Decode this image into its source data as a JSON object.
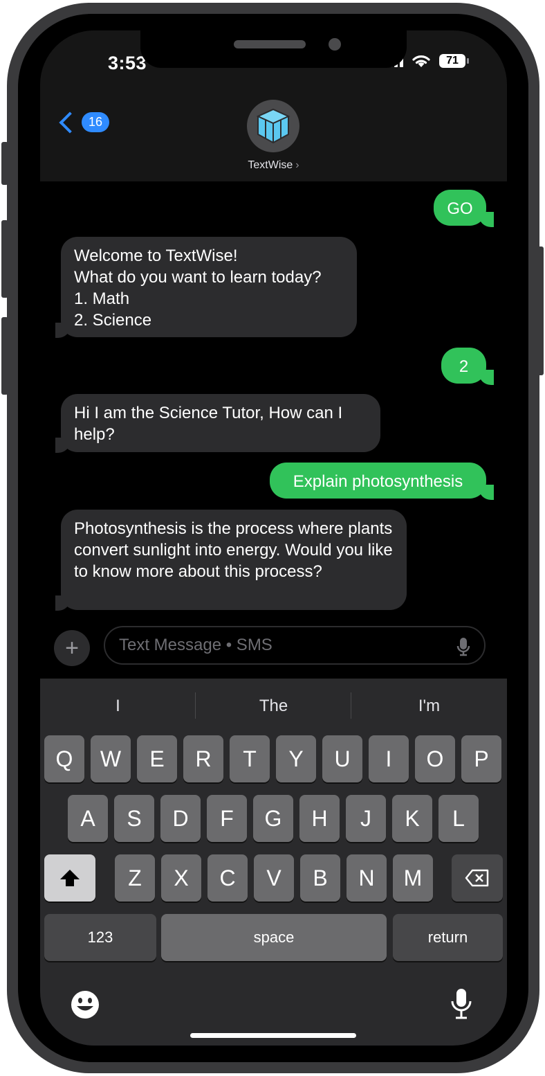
{
  "status": {
    "time": "3:53",
    "battery": "71"
  },
  "header": {
    "back_count": "16",
    "contact_name": "TextWise"
  },
  "messages": [
    {
      "from": "me",
      "text": "GO"
    },
    {
      "from": "them",
      "text": "Welcome to TextWise!\nWhat do you want to learn today?\n 1. Math\n 2. Science"
    },
    {
      "from": "me",
      "text": "2"
    },
    {
      "from": "them",
      "text": "Hi I am the Science Tutor, How can I help?"
    },
    {
      "from": "me",
      "text": "Explain photosynthesis"
    },
    {
      "from": "them",
      "text": "Photosynthesis is the process where plants convert sunlight into energy. Would you like to know more about this process?"
    }
  ],
  "composer": {
    "placeholder": "Text Message • SMS"
  },
  "keyboard": {
    "suggestions": [
      "I",
      "The",
      "I'm"
    ],
    "row1": [
      "Q",
      "W",
      "E",
      "R",
      "T",
      "Y",
      "U",
      "I",
      "O",
      "P"
    ],
    "row2": [
      "A",
      "S",
      "D",
      "F",
      "G",
      "H",
      "J",
      "K",
      "L"
    ],
    "row3": [
      "Z",
      "X",
      "C",
      "V",
      "B",
      "N",
      "M"
    ],
    "numbers_label": "123",
    "space_label": "space",
    "return_label": "return"
  },
  "colors": {
    "accent": "#2f8bff",
    "outgoing": "#31c25a",
    "incoming": "#2c2c2e"
  }
}
